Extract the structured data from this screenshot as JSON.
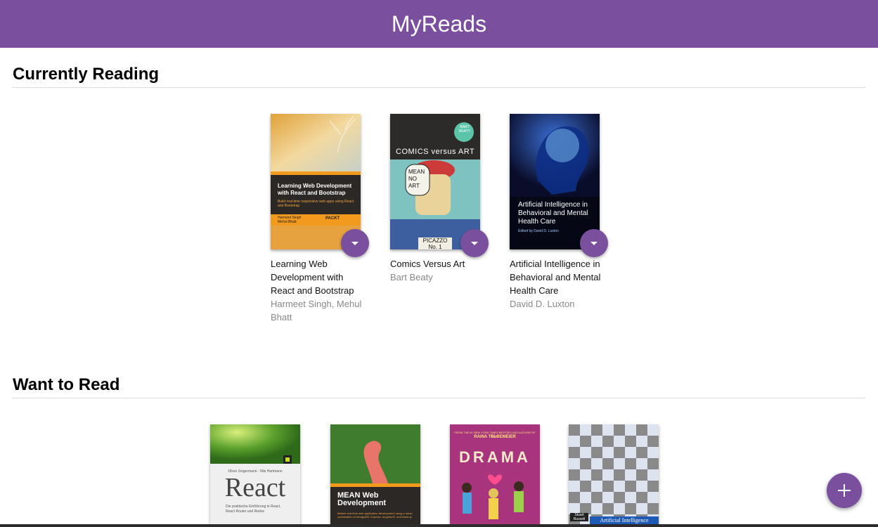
{
  "app": {
    "title": "MyReads"
  },
  "shelves": [
    {
      "title": "Currently Reading",
      "books": [
        {
          "title": "Learning Web Development with React and Bootstrap",
          "authors": "Harmeet Singh, Mehul Bhatt",
          "cover_text": {
            "headline": "Learning Web Development with React and Bootstrap",
            "subtitle": "Build real-time responsive web apps using React and Bootstrap",
            "authors": "Harmeet Singh\nMehul Bhatt",
            "publisher": "PACKT"
          }
        },
        {
          "title": "Comics Versus Art",
          "authors": "Bart Beaty",
          "cover_text": {
            "headline": "COMICS versus ART",
            "badge": "BART BEATY",
            "bubble": "MEAN NO ART",
            "sign": "PICAZZO No. 1"
          }
        },
        {
          "title": "Artificial Intelligence in Behavioral and Mental Health Care",
          "authors": "David D. Luxton",
          "cover_text": {
            "headline": "Artificial Intelligence in Behavioral and Mental Health Care",
            "editor": "Edited by David D. Luxton"
          }
        }
      ]
    },
    {
      "title": "Want to Read",
      "books": [
        {
          "cover_text": {
            "authors": "Oliver Zeigermann · Nils Hartmann",
            "headline": "React",
            "subtitle": "Die praktische Einführung in React, React Router und Redux"
          }
        },
        {
          "cover_text": {
            "headline": "MEAN Web Development",
            "subtitle": "Master real-time web application development using a mean combination of MongoDB, Express, AngularJS, and Node.js"
          }
        },
        {
          "cover_text": {
            "top": "FROM THE #1 NEW YORK TIMES BESTSELLING AUTHOR OF SMILE",
            "author": "RAINA TELGEMEIER",
            "headline": "DRAMA"
          }
        },
        {
          "cover_text": {
            "author": "Stuart Russell",
            "headline": "Artificial Intelligence"
          }
        }
      ]
    }
  ],
  "actions": {
    "add_icon": "plus-icon",
    "shelf_changer_icon": "caret-down-icon"
  },
  "colors": {
    "header": "#7a4f9e",
    "accent": "#7a4f9e",
    "author_text": "#888888"
  }
}
